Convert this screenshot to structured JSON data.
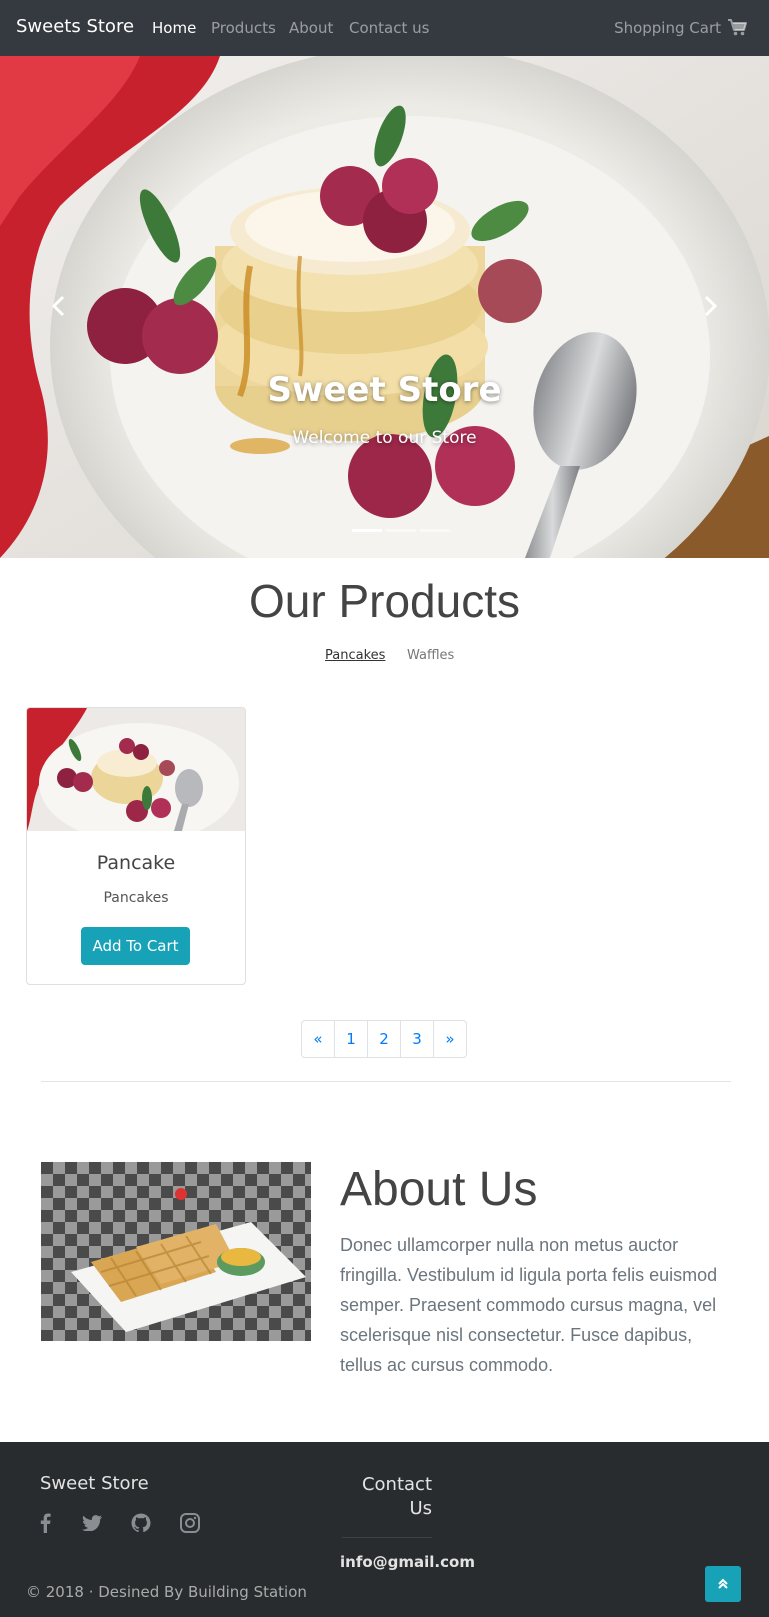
{
  "navbar": {
    "brand": "Sweets Store",
    "links": [
      "Home",
      "Products",
      "About",
      "Contact us"
    ],
    "cart_label": "Shopping Cart",
    "cart_icon": "shopping-cart-icon"
  },
  "carousel": {
    "title": "Sweet Store",
    "subtitle": "Welcome to our Store",
    "prev_icon": "chevron-left-icon",
    "next_icon": "chevron-right-icon",
    "slide_count": 3,
    "active_slide": 1
  },
  "products": {
    "heading": "Our Products",
    "filters": [
      "Pancakes",
      "Waffles"
    ],
    "active_filter": "Pancakes",
    "items": [
      {
        "name": "Pancake",
        "category": "Pancakes",
        "button": "Add To Cart"
      }
    ],
    "pagination": [
      "«",
      "1",
      "2",
      "3",
      "»"
    ]
  },
  "about": {
    "heading": "About Us",
    "text": "Donec ullamcorper nulla non metus auctor fringilla. Vestibulum id ligula porta felis euismod semper. Praesent commodo cursus magna, vel scelerisque nisl consectetur. Fusce dapibus, tellus ac cursus commodo."
  },
  "footer": {
    "brand": "Sweet Store",
    "social_icons": [
      "facebook-icon",
      "twitter-icon",
      "github-icon",
      "instagram-icon"
    ],
    "contact_title": "Contact Us",
    "email": "info@gmail.com",
    "copyright": "© 2018 · Desined By Building Station",
    "back_to_top_icon": "double-chevron-up-icon"
  },
  "colors": {
    "navbar_bg": "#343a40",
    "footer_bg": "#292c2f",
    "accent": "#17a2b8",
    "link": "#007bff"
  }
}
